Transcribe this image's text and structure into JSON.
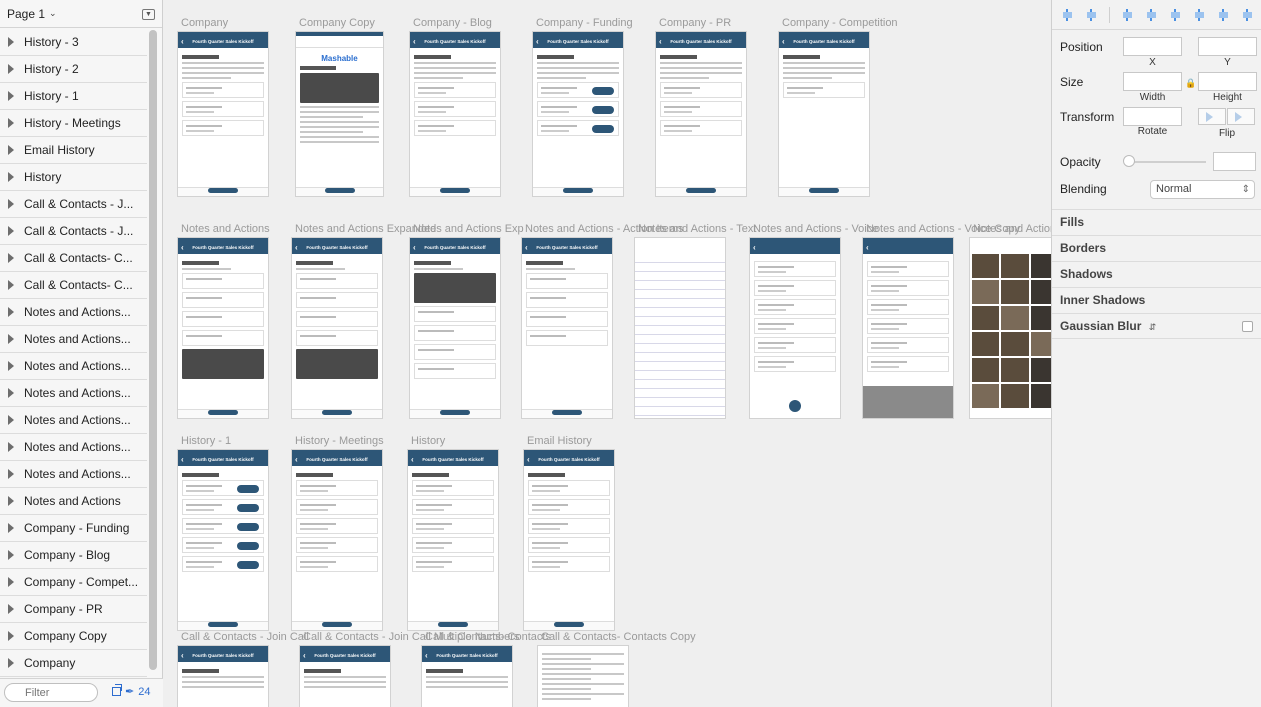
{
  "page_selector": {
    "label": "Page 1"
  },
  "layers": [
    "History - 3",
    "History - 2",
    "History - 1",
    "History - Meetings",
    "Email History",
    "History",
    "Call & Contacts - J...",
    "Call & Contacts - J...",
    "Call & Contacts- C...",
    "Call & Contacts- C...",
    "Notes and Actions...",
    "Notes and Actions...",
    "Notes and Actions...",
    "Notes and Actions...",
    "Notes and Actions...",
    "Notes and Actions...",
    "Notes and Actions...",
    "Notes and Actions",
    "Company - Funding",
    "Company - Blog",
    "Company - Compet...",
    "Company - PR",
    "Company Copy",
    "Company"
  ],
  "filter": {
    "placeholder": "Filter",
    "count": "24"
  },
  "artboards": [
    {
      "title": "Company",
      "nav": "Fourth Quarter Sales Kickoff",
      "variant": "company"
    },
    {
      "title": "Company Copy",
      "nav": "Mashable",
      "variant": "article"
    },
    {
      "title": "Company - Blog",
      "nav": "Fourth Quarter Sales Kickoff",
      "variant": "company"
    },
    {
      "title": "Company - Funding",
      "nav": "Fourth Quarter Sales Kickoff",
      "variant": "funding"
    },
    {
      "title": "Company - PR",
      "nav": "Fourth Quarter Sales Kickoff",
      "variant": "company"
    },
    {
      "title": "Company - Competition",
      "nav": "Fourth Quarter Sales Kickoff",
      "variant": "short"
    },
    {
      "title": "Notes and Actions",
      "nav": "Fourth Quarter Sales Kickoff",
      "variant": "notes"
    },
    {
      "title": "Notes and Actions Expanded",
      "nav": "Fourth Quarter Sales Kickoff",
      "variant": "notes"
    },
    {
      "title": "Notes and Actions Exp",
      "nav": "Fourth Quarter Sales Kickoff",
      "variant": "notes-img"
    },
    {
      "title": "Notes and Actions - Action Items",
      "nav": "Fourth Quarter Sales Kickoff",
      "variant": "actions"
    },
    {
      "title": "Notes and Actions - Text",
      "nav": "",
      "variant": "lined"
    },
    {
      "title": "Notes and Actions - Voice",
      "nav": "",
      "variant": "voice"
    },
    {
      "title": "Notes and Actions - Voice Copy",
      "nav": "",
      "variant": "voice-wave"
    },
    {
      "title": "Notes and Actions - Photo",
      "nav": "",
      "variant": "photos"
    },
    {
      "title": "History - 1",
      "nav": "Fourth Quarter Sales Kickoff",
      "variant": "history"
    },
    {
      "title": "History - Meetings",
      "nav": "Fourth Quarter Sales Kickoff",
      "variant": "history-list"
    },
    {
      "title": "History",
      "nav": "Fourth Quarter Sales Kickoff",
      "variant": "history-list"
    },
    {
      "title": "Email History",
      "nav": "Fourth Quarter Sales Kickoff",
      "variant": "history-list"
    },
    {
      "title": "Call & Contacts - Join Call",
      "nav": "Fourth Quarter Sales Kickoff",
      "variant": "contacts"
    },
    {
      "title": "Call & Contacts - Join Call Multiple Numbers",
      "nav": "Fourth Quarter Sales Kickoff",
      "variant": "contacts"
    },
    {
      "title": "Call & Contacts- Contacts",
      "nav": "Fourth Quarter Sales Kickoff",
      "variant": "contacts"
    },
    {
      "title": "Call & Contacts- Contacts Copy",
      "nav": "",
      "variant": "search"
    }
  ],
  "inspector": {
    "position_label": "Position",
    "x_label": "X",
    "y_label": "Y",
    "size_label": "Size",
    "width_label": "Width",
    "height_label": "Height",
    "transform_label": "Transform",
    "rotate_label": "Rotate",
    "flip_label": "Flip",
    "opacity_label": "Opacity",
    "blending_label": "Blending",
    "blending_value": "Normal",
    "fills_label": "Fills",
    "borders_label": "Borders",
    "shadows_label": "Shadows",
    "inner_shadows_label": "Inner Shadows",
    "gaussian_blur_label": "Gaussian Blur"
  },
  "colors": {
    "nav_bar": "#2d5677",
    "accent": "#2d6ccf"
  }
}
